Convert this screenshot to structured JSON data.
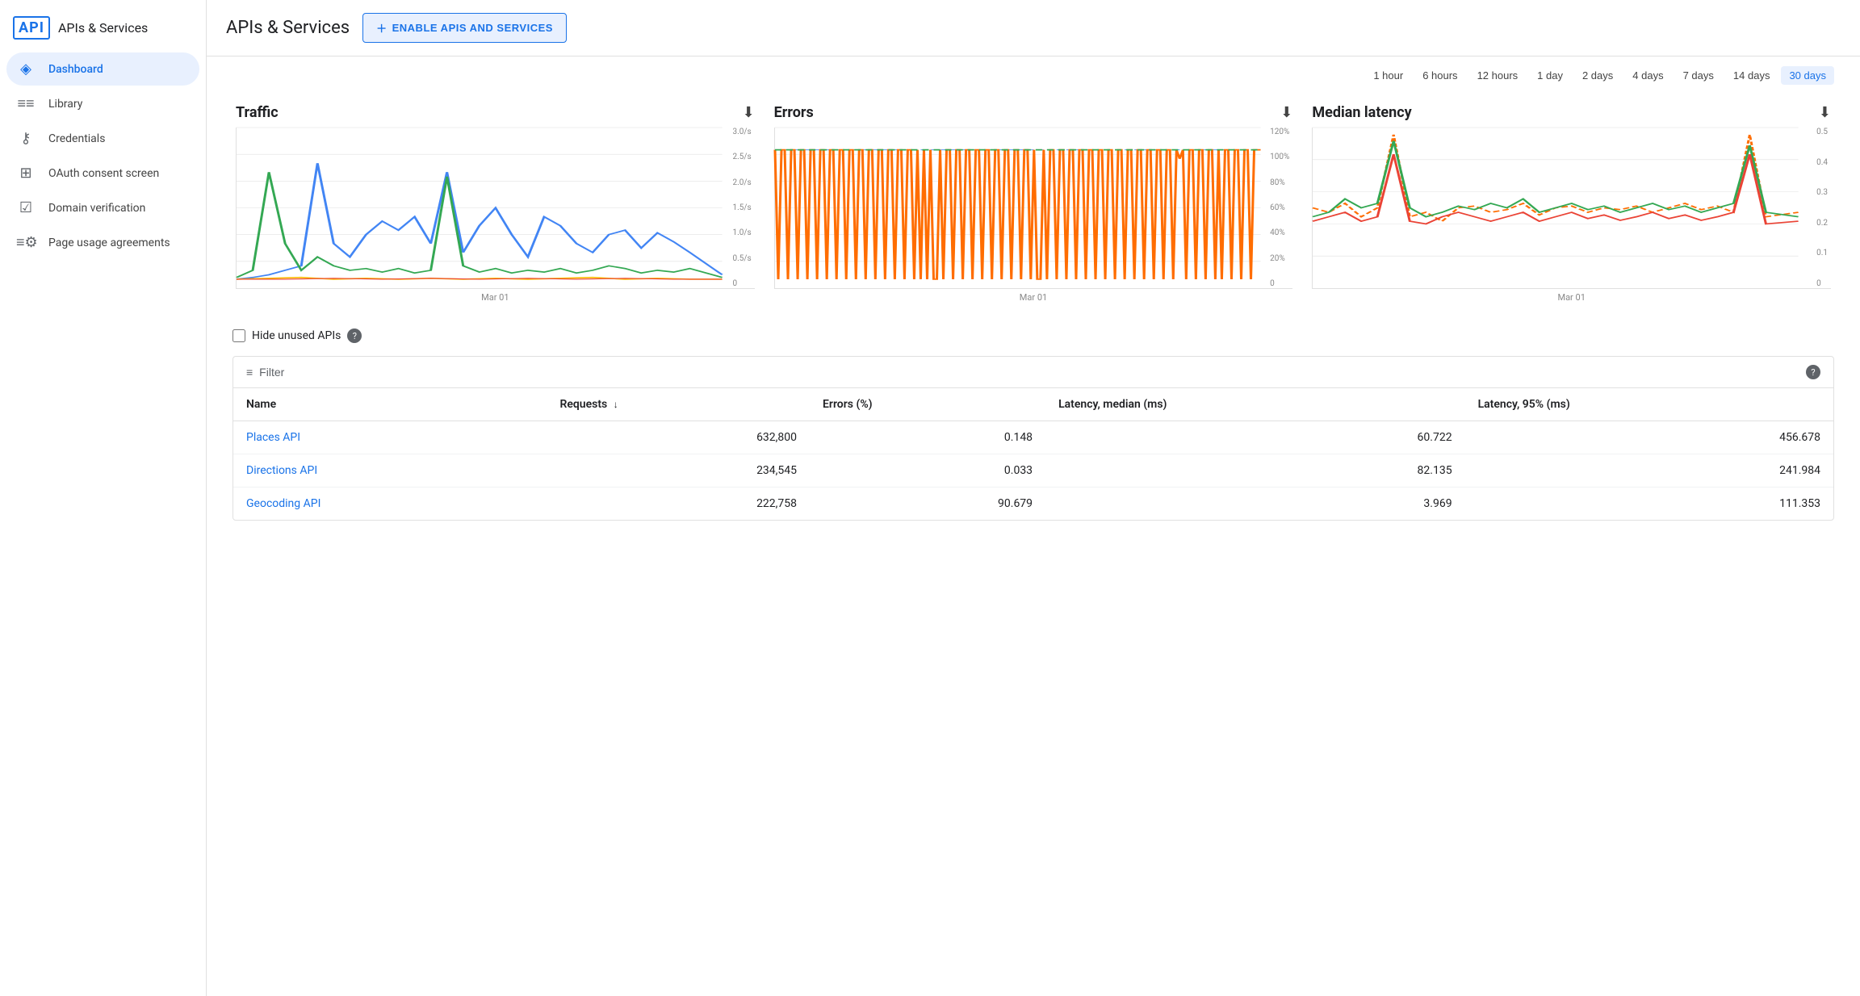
{
  "sidebar": {
    "logo_text": "API",
    "app_name": "APIs & Services",
    "items": [
      {
        "id": "dashboard",
        "label": "Dashboard",
        "icon": "◈",
        "active": true
      },
      {
        "id": "library",
        "label": "Library",
        "icon": "≡≡",
        "active": false
      },
      {
        "id": "credentials",
        "label": "Credentials",
        "icon": "⚷",
        "active": false
      },
      {
        "id": "oauth",
        "label": "OAuth consent screen",
        "icon": "⊞",
        "active": false
      },
      {
        "id": "domain",
        "label": "Domain verification",
        "icon": "☑",
        "active": false
      },
      {
        "id": "page-usage",
        "label": "Page usage agreements",
        "icon": "≡⚙",
        "active": false
      }
    ]
  },
  "header": {
    "title": "APIs & Services",
    "enable_button": "ENABLE APIS AND SERVICES"
  },
  "time_range": {
    "options": [
      "1 hour",
      "6 hours",
      "12 hours",
      "1 day",
      "2 days",
      "4 days",
      "7 days",
      "14 days",
      "30 days"
    ],
    "active": "30 days"
  },
  "charts": {
    "traffic": {
      "title": "Traffic",
      "x_label": "Mar 01",
      "y_labels": [
        "3.0/s",
        "2.5/s",
        "2.0/s",
        "1.5/s",
        "1.0/s",
        "0.5/s",
        "0"
      ]
    },
    "errors": {
      "title": "Errors",
      "x_label": "Mar 01",
      "y_labels": [
        "120%",
        "100%",
        "80%",
        "60%",
        "40%",
        "20%",
        "0"
      ]
    },
    "latency": {
      "title": "Median latency",
      "x_label": "Mar 01",
      "y_labels": [
        "0.5",
        "0.4",
        "0.3",
        "0.2",
        "0.1",
        "0"
      ]
    }
  },
  "filter_section": {
    "hide_unused_label": "Hide unused APIs",
    "filter_placeholder": "Filter",
    "table": {
      "columns": [
        {
          "id": "name",
          "label": "Name",
          "sortable": false
        },
        {
          "id": "requests",
          "label": "Requests",
          "sortable": true
        },
        {
          "id": "errors",
          "label": "Errors (%)",
          "sortable": false
        },
        {
          "id": "latency_median",
          "label": "Latency, median (ms)",
          "sortable": false
        },
        {
          "id": "latency_95",
          "label": "Latency, 95% (ms)",
          "sortable": false
        }
      ],
      "rows": [
        {
          "name": "Places API",
          "requests": "632,800",
          "errors": "0.148",
          "latency_median": "60.722",
          "latency_95": "456.678"
        },
        {
          "name": "Directions API",
          "requests": "234,545",
          "errors": "0.033",
          "latency_median": "82.135",
          "latency_95": "241.984"
        },
        {
          "name": "Geocoding API",
          "requests": "222,758",
          "errors": "90.679",
          "latency_median": "3.969",
          "latency_95": "111.353"
        }
      ]
    }
  }
}
